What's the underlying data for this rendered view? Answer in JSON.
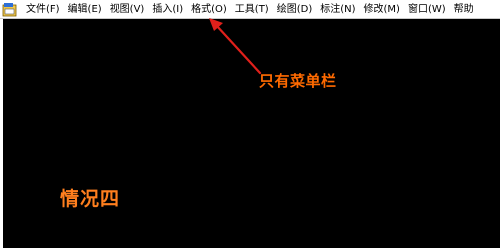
{
  "menubar": {
    "icon": "app-icon",
    "items": [
      "文件(F)",
      "编辑(E)",
      "视图(V)",
      "插入(I)",
      "格式(O)",
      "工具(T)",
      "绘图(D)",
      "标注(N)",
      "修改(M)",
      "窗口(W)",
      "帮助"
    ]
  },
  "annotation": {
    "text": "只有菜单栏",
    "color": "#ff6a00",
    "arrow_color": "#e0201b"
  },
  "canvas": {
    "background": "#000000",
    "case_label": "情况四",
    "case_label_color": "#ff7f1e"
  }
}
